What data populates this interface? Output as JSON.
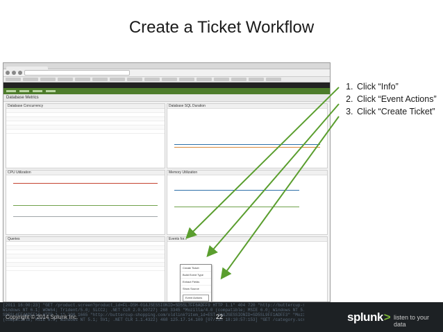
{
  "slide": {
    "title": "Create a Ticket Workflow",
    "steps": [
      "Click “Info”",
      "Click “Event Actions”",
      "Click “Create Ticket”"
    ]
  },
  "screenshot": {
    "dashboard_title": "Database Metrics",
    "panels": {
      "concurrency": "Database Concurrency",
      "sql_duration": "Database SQL Duration",
      "cpu": "CPU Utilization",
      "memory": "Memory Utilization",
      "queries": "Queries",
      "events": "Events for..."
    },
    "event_menu_items": [
      "Create Ticket",
      "Build Event Type",
      "Extract Fields",
      "Show Source"
    ],
    "event_actions_button": "Event Actions"
  },
  "footer": {
    "copyright": "Copyright © 2014 Splunk Inc.",
    "page_number": "22",
    "logo": "splunk",
    "logo_mark": ">",
    "tagline": "listen to your data",
    "code_lines": [
      "[2011 16:00:23] \"GET /product.screen?product_id=FL-DSH-01&JSESSIONID=SD5SL7FF6ADFF9 HTTP 1.1\" 404 720 \"http://buttercup-shopping.com/cart.do?action=view&itemId=EST-6&product_id=FI-SW-01\"",
      "Windows NT 6.1; WOW64; Trident/5.0; SLCC2; .NET CLR 2.0.50727) 268 3345 \"Mozilla/4.0 (compatible; MSIE 6.0; Windows NT 5.1; SV1; .NET CLR 1.1.4322)\" 468 125.17.14.100",
      "SD5SL4FF4ADFF10 HTTP 1.1\" 200 1665 \"http://buttercup-shopping.com/oldlink?item_id=EST-26&JSESSIONID=SD5SL9FF1ADFF3\" \"Mozilla/5.0 (Windows; U;",
      "(compatible; MSIE 6.0; Windows NT 5.1; SV1; .NET CLR 1.1.4322) 468 125.17.14.100 [07/Jan 18:10:57:153] \"GET /category.screen?category_id=GIFTS&JSESSIONID=SD1SL4FF10ADFF10 HTTP 1.1\" 404 720"
    ]
  }
}
